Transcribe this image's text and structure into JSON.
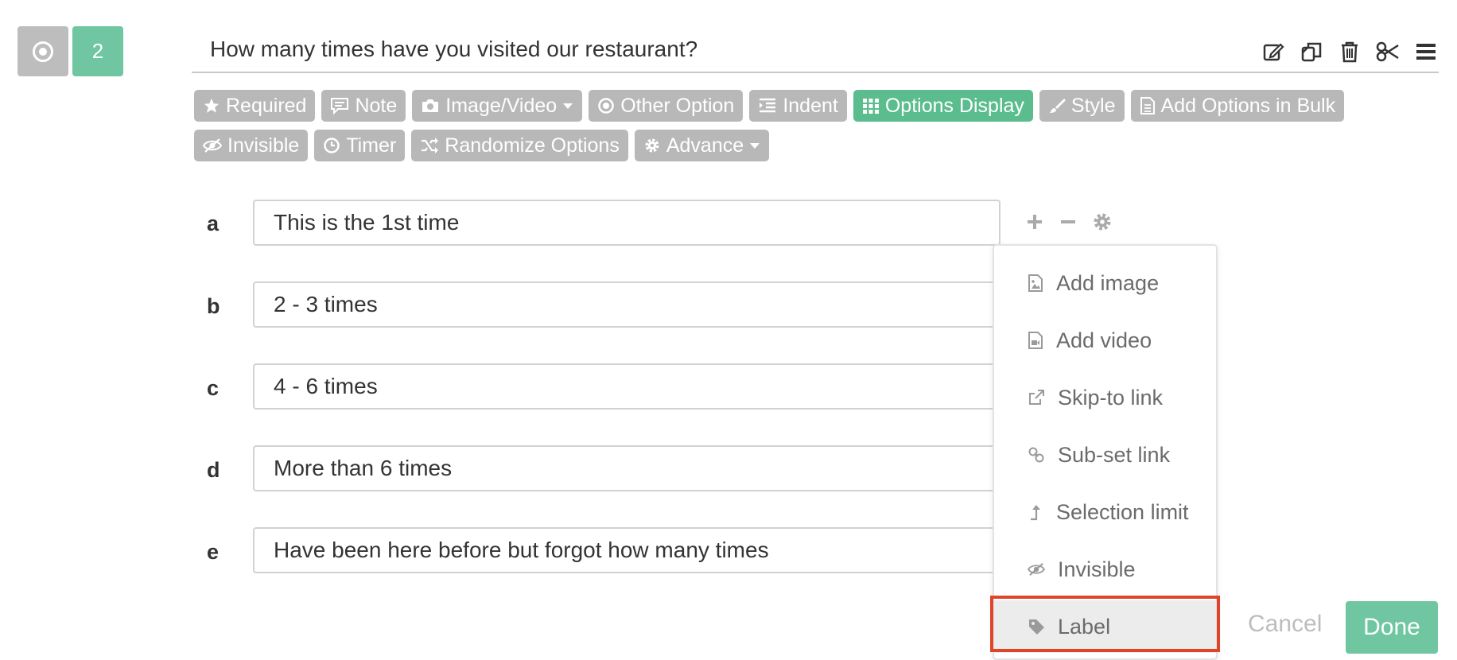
{
  "question": {
    "number": "2",
    "type_icon": "radio-icon",
    "title": "How many times have you visited our restaurant?",
    "actions": [
      "edit-icon",
      "copy-icon",
      "trash-icon",
      "scissors-icon",
      "menu-icon"
    ]
  },
  "toolbar": {
    "required": "Required",
    "note": "Note",
    "image_video": "Image/Video",
    "other_option": "Other Option",
    "indent": "Indent",
    "options_display": "Options Display",
    "style": "Style",
    "add_bulk": "Add Options in Bulk",
    "invisible": "Invisible",
    "timer": "Timer",
    "randomize": "Randomize Options",
    "advance": "Advance"
  },
  "options": [
    {
      "letter": "a",
      "text": "This is the 1st time"
    },
    {
      "letter": "b",
      "text": "2 - 3 times"
    },
    {
      "letter": "c",
      "text": "4 - 6 times"
    },
    {
      "letter": "d",
      "text": "More than 6 times"
    },
    {
      "letter": "e",
      "text": "Have been here before but forgot how many times"
    }
  ],
  "option_actions": [
    "plus-icon",
    "minus-icon",
    "gear-icon"
  ],
  "menu": {
    "items": [
      {
        "label": "Add image",
        "icon": "image-file-icon"
      },
      {
        "label": "Add video",
        "icon": "video-file-icon"
      },
      {
        "label": "Skip-to link",
        "icon": "external-link-icon"
      },
      {
        "label": "Sub-set link",
        "icon": "link-icon"
      },
      {
        "label": "Selection limit",
        "icon": "arrow-up-icon"
      },
      {
        "label": "Invisible",
        "icon": "eye-slash-icon"
      },
      {
        "label": "Label",
        "icon": "tag-icon"
      }
    ],
    "selected_index": 6
  },
  "footer": {
    "cancel": "Cancel",
    "done": "Done"
  },
  "colors": {
    "accent": "#6fc6a0",
    "toolbar_gray": "#b8b8b8",
    "highlight": "#e0452b"
  }
}
